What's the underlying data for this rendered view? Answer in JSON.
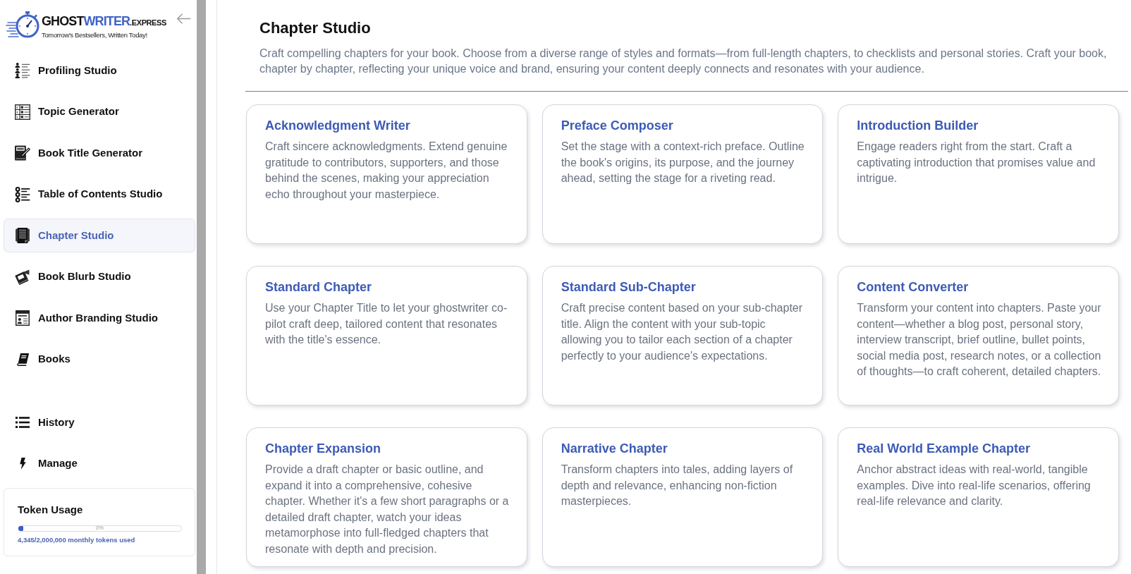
{
  "sidebar": {
    "logo": {
      "wordmark": [
        "GHOST",
        "WRITER",
        ".EXPRESS"
      ],
      "tagline": "Tomorrow's Bestsellers, Written Today!"
    },
    "nav_items": [
      {
        "label": "Profiling Studio",
        "selected": false
      },
      {
        "label": "Topic Generator",
        "selected": false
      },
      {
        "label": "Book Title Generator",
        "selected": false
      },
      {
        "label": "Table of Contents Studio",
        "selected": false
      },
      {
        "label": "Chapter Studio",
        "selected": true
      },
      {
        "label": "Book Blurb Studio",
        "selected": false
      },
      {
        "label": "Author Branding Studio",
        "selected": false
      },
      {
        "label": "Books",
        "selected": false
      }
    ],
    "secondary_items": [
      {
        "label": "History",
        "selected": false
      },
      {
        "label": "Manage",
        "selected": false
      }
    ],
    "token_usage": {
      "title": "Token Usage",
      "level": 0.03,
      "reading": "0%",
      "caption": "4,345/2,000,000 monthly tokens used"
    }
  },
  "main": {
    "title": "Chapter Studio",
    "description": "Craft compelling chapters for your book. Choose from a diverse range of styles and formats—from full-length chapters, to checklists and personal stories. Craft your book, chapter by chapter, reflecting your unique voice and brand, ensuring your content deeply connects and resonates with your audience.",
    "cards": [
      {
        "title": "Acknowledgment Writer",
        "description": "Craft sincere acknowledgments. Extend genuine gratitude to contributors, supporters, and those behind the scenes, making your appreciation echo throughout your masterpiece."
      },
      {
        "title": "Preface Composer",
        "description": "Set the stage with a context-rich preface. Outline the book's origins, its purpose, and the journey ahead, setting the stage for a riveting read."
      },
      {
        "title": "Introduction Builder",
        "description": "Engage readers right from the start. Craft a captivating introduction that promises value and intrigue."
      },
      {
        "title": "Standard Chapter",
        "description": "Use your Chapter Title to let your ghostwriter co-pilot craft deep, tailored content that resonates with the title's essence."
      },
      {
        "title": "Standard Sub-Chapter",
        "description": "Craft precise content based on your sub-chapter title. Align the content with your sub-topic allowing you to tailor each section of a chapter perfectly to your audience's expectations."
      },
      {
        "title": "Content Converter",
        "description": "Transform your content into chapters. Paste your content—whether a blog post, personal story, interview transcript, brief outline, bullet points, social media post, research notes, or a collection of thoughts—to craft coherent, detailed chapters."
      },
      {
        "title": "Chapter Expansion",
        "description": "Provide a draft chapter or basic outline, and expand it into a comprehensive, cohesive chapter. Whether it's a few short paragraphs or a detailed draft chapter, watch your ideas metamorphose into full-fledged chapters that resonate with depth and precision."
      },
      {
        "title": "Narrative Chapter",
        "description": "Transform chapters into tales, adding layers of depth and relevance, enhancing non-fiction masterpieces."
      },
      {
        "title": "Real World Example Chapter",
        "description": "Anchor abstract ideas with real-world, tangible examples. Dive into real-life scenarios, offering real-life relevance and clarity."
      }
    ]
  }
}
